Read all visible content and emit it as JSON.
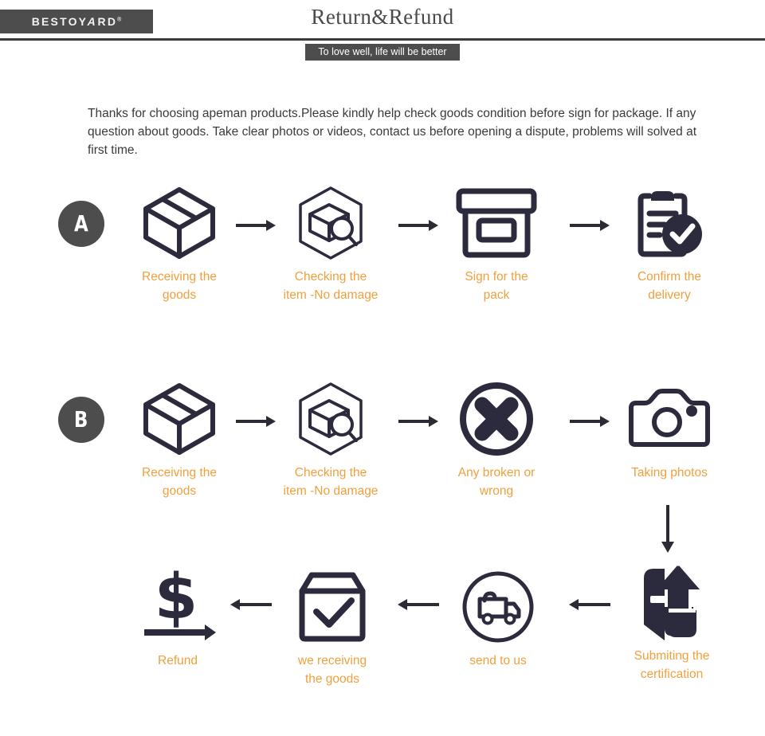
{
  "header": {
    "logo": "BESTOY",
    "logo_a": "A",
    "logo_tail": "RD",
    "logo_reg": "®",
    "title": "Return&Refund",
    "tagline": "To love well, life will be better"
  },
  "intro": {
    "text": "Thanks for choosing apeman products.Please kindly help check goods condition before sign for package. If any question about goods. Take clear photos or videos, contact us before opening a dispute, problems will solved at first time."
  },
  "colors": {
    "accent_orange": "#f0a03c",
    "icon_navy": "#2b2b3d",
    "badge_gray": "#4d4d4d",
    "rule_dark": "#3b3b3b",
    "body_text": "#3a3a3a"
  },
  "flows": [
    {
      "badge": "A",
      "steps": [
        {
          "icon": "box-icon",
          "line1": "Receiving the",
          "line2": "goods"
        },
        {
          "icon": "inspect-box-icon",
          "line1": "Checking the",
          "line2": "item -No damage"
        },
        {
          "icon": "sign-pack-icon",
          "line1": "Sign for the",
          "line2": "pack"
        },
        {
          "icon": "clipboard-check-icon",
          "line1": "Confirm the",
          "line2": "delivery"
        }
      ]
    },
    {
      "badge": "B",
      "steps": [
        {
          "icon": "box-icon",
          "line1": "Receiving the",
          "line2": "goods"
        },
        {
          "icon": "inspect-box-icon",
          "line1": "Checking the",
          "line2": "item -No damage"
        },
        {
          "icon": "circle-x-icon",
          "line1": "Any broken or",
          "line2": "wrong"
        },
        {
          "icon": "camera-icon",
          "line1": "Taking photos",
          "line2": ""
        }
      ]
    }
  ],
  "flow_return": {
    "steps": [
      {
        "icon": "dollar-refund-icon",
        "line1": "Refund",
        "line2": ""
      },
      {
        "icon": "box-check-icon",
        "line1": "we receiving",
        "line2": "the goods"
      },
      {
        "icon": "truck-circle-icon",
        "line1": "send  to us",
        "line2": ""
      },
      {
        "icon": "upload-doc-icon",
        "line1": "Submiting the",
        "line2": "certification"
      }
    ]
  },
  "arrows": {
    "right": "arrow-right-icon",
    "left": "arrow-left-icon",
    "down": "arrow-down-icon"
  }
}
